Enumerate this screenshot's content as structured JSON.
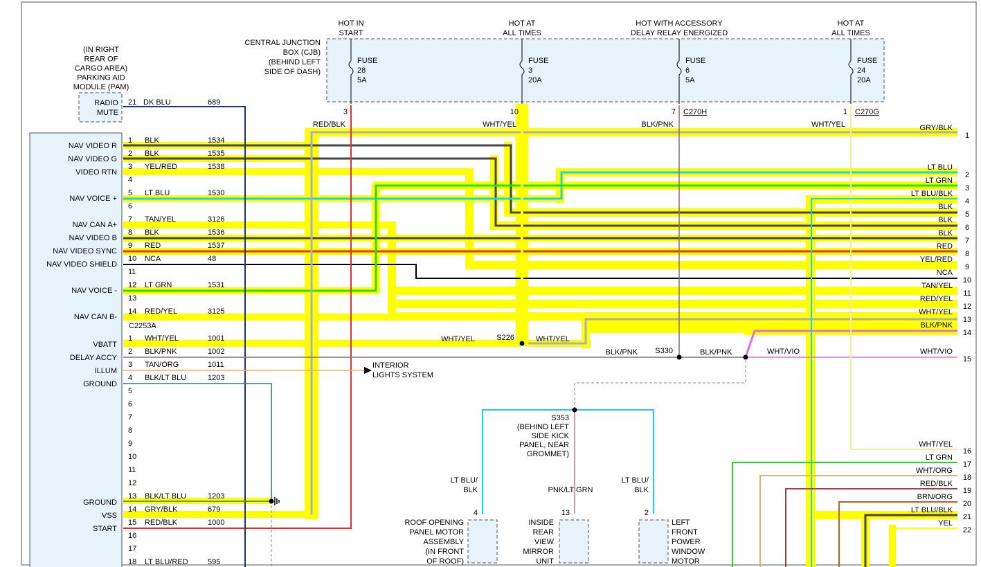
{
  "fuse_panel": {
    "title_lines": [
      "CENTRAL JUNCTION",
      "BOX (CJB)",
      "(BEHIND LEFT",
      "SIDE OF DASH)"
    ],
    "fuses": [
      {
        "hot": [
          "HOT IN",
          "START"
        ],
        "label": "FUSE",
        "number": "28",
        "amps": "5A",
        "pin": "3",
        "connector": "",
        "wire": "RED/BLK"
      },
      {
        "hot": [
          "HOT AT",
          "ALL TIMES"
        ],
        "label": "FUSE",
        "number": "3",
        "amps": "20A",
        "pin": "10",
        "connector": "",
        "wire": "WHT/YEL"
      },
      {
        "hot": [
          "HOT WITH ACCESSORY",
          "DELAY RELAY ENERGIZED"
        ],
        "label": "FUSE",
        "number": "6",
        "amps": "5A",
        "pin": "7",
        "connector": "C270H",
        "wire": "BLK/PNK"
      },
      {
        "hot": [
          "HOT AT",
          "ALL TIMES"
        ],
        "label": "FUSE",
        "number": "24",
        "amps": "20A",
        "pin": "1",
        "connector": "C270G",
        "wire": "WHT/YEL"
      }
    ]
  },
  "pam": {
    "title_lines": [
      "(IN RIGHT",
      "REAR OF",
      "CARGO AREA)",
      "PARKING AID",
      "MODULE (PAM)"
    ],
    "box_lines": [
      "RADIO",
      "MUTE"
    ],
    "pin": "21",
    "color": "DK BLU",
    "circuit": "689"
  },
  "module_a": {
    "connector": "C2253A",
    "pins": [
      {
        "pin": "1",
        "color": "BLK",
        "circuit": "1534",
        "func": "NAV VIDEO R"
      },
      {
        "pin": "2",
        "color": "BLK",
        "circuit": "1535",
        "func": "NAV VIDEO G"
      },
      {
        "pin": "3",
        "color": "YEL/RED",
        "circuit": "1538",
        "func": "VIDEO RTN"
      },
      {
        "pin": "4",
        "color": "",
        "circuit": "",
        "func": ""
      },
      {
        "pin": "5",
        "color": "LT BLU",
        "circuit": "1530",
        "func": "NAV VOICE +"
      },
      {
        "pin": "6",
        "color": "",
        "circuit": "",
        "func": ""
      },
      {
        "pin": "7",
        "color": "TAN/YEL",
        "circuit": "3126",
        "func": "NAV CAN A+"
      },
      {
        "pin": "8",
        "color": "BLK",
        "circuit": "1536",
        "func": "NAV VIDEO B"
      },
      {
        "pin": "9",
        "color": "RED",
        "circuit": "1537",
        "func": "NAV VIDEO SYNC"
      },
      {
        "pin": "10",
        "color": "NCA",
        "circuit": "48",
        "func": "NAV VIDEO SHIELD"
      },
      {
        "pin": "11",
        "color": "",
        "circuit": "",
        "func": ""
      },
      {
        "pin": "12",
        "color": "LT GRN",
        "circuit": "1531",
        "func": "NAV VOICE -"
      },
      {
        "pin": "13",
        "color": "",
        "circuit": "",
        "func": ""
      },
      {
        "pin": "14",
        "color": "RED/YEL",
        "circuit": "3125",
        "func": "NAV CAN B-"
      }
    ]
  },
  "module_b": {
    "pins": [
      {
        "pin": "1",
        "color": "WHT/YEL",
        "circuit": "1001",
        "func": "VBATT"
      },
      {
        "pin": "2",
        "color": "BLK/PNK",
        "circuit": "1002",
        "func": "DELAY ACCY"
      },
      {
        "pin": "3",
        "color": "TAN/ORG",
        "circuit": "1011",
        "func": "ILLUM"
      },
      {
        "pin": "4",
        "color": "BLK/LT BLU",
        "circuit": "1203",
        "func": "GROUND"
      },
      {
        "pin": "5",
        "color": "",
        "circuit": "",
        "func": ""
      },
      {
        "pin": "6",
        "color": "",
        "circuit": "",
        "func": ""
      },
      {
        "pin": "7",
        "color": "",
        "circuit": "",
        "func": ""
      },
      {
        "pin": "8",
        "color": "",
        "circuit": "",
        "func": ""
      },
      {
        "pin": "9",
        "color": "",
        "circuit": "",
        "func": ""
      },
      {
        "pin": "10",
        "color": "",
        "circuit": "",
        "func": ""
      },
      {
        "pin": "11",
        "color": "",
        "circuit": "",
        "func": ""
      },
      {
        "pin": "12",
        "color": "",
        "circuit": "",
        "func": ""
      },
      {
        "pin": "13",
        "color": "BLK/LT BLU",
        "circuit": "1203",
        "func": "GROUND"
      },
      {
        "pin": "14",
        "color": "GRY/BLK",
        "circuit": "679",
        "func": "VSS"
      },
      {
        "pin": "15",
        "color": "RED/BLK",
        "circuit": "1000",
        "func": "START"
      },
      {
        "pin": "16",
        "color": "",
        "circuit": "",
        "func": ""
      },
      {
        "pin": "17",
        "color": "",
        "circuit": "",
        "func": ""
      },
      {
        "pin": "18",
        "color": "LT BLU/RED",
        "circuit": "595",
        "func": ""
      }
    ]
  },
  "right_connector": [
    {
      "pin": "1",
      "color": "GRY/BLK"
    },
    {
      "pin": "2",
      "color": "LT BLU"
    },
    {
      "pin": "3",
      "color": "LT GRN"
    },
    {
      "pin": "3",
      "color": "LT BLU/BLK"
    },
    {
      "pin": "4",
      "color": "BLK"
    },
    {
      "pin": "5",
      "color": "BLK"
    },
    {
      "pin": "6",
      "color": "BLK"
    },
    {
      "pin": "7",
      "color": "RED"
    },
    {
      "pin": "8",
      "color": "YEL/RED"
    },
    {
      "pin": "9",
      "color": "NCA"
    },
    {
      "pin": "10",
      "color": "TAN/YEL"
    },
    {
      "pin": "11",
      "color": "RED/YEL"
    },
    {
      "pin": "12",
      "color": "WHT/YEL"
    },
    {
      "pin": "13",
      "color": "BLK/PNK"
    },
    {
      "pin": "14",
      "color": "WHT/VIO"
    },
    {
      "pin": "15",
      "color": "WHT/YEL"
    },
    {
      "pin": "16",
      "color": "LT GRN"
    },
    {
      "pin": "17",
      "color": "WHT/ORG"
    },
    {
      "pin": "18",
      "color": "RED/BLK"
    },
    {
      "pin": "19",
      "color": "BRN/ORG"
    },
    {
      "pin": "20",
      "color": "LT BLU/BLK"
    },
    {
      "pin": "21",
      "color": "YEL"
    },
    {
      "pin": "22",
      "color": ""
    }
  ],
  "splices": {
    "s226": "S226",
    "s226_left": "WHT/YEL",
    "s226_right": "WHT/YEL",
    "s330": "S330",
    "s330_left": "BLK/PNK",
    "s330_right": "BLK/PNK",
    "wht_vio": "WHT/VIO",
    "s353_lines": [
      "S353",
      "(BEHIND LEFT",
      "SIDE KICK",
      "PANEL, NEAR",
      "GROMMET)"
    ]
  },
  "interior_lights": [
    "INTERIOR",
    "LIGHTS SYSTEM"
  ],
  "components": [
    {
      "pin": "4",
      "wire_lines": [
        "LT BLU/",
        "BLK"
      ],
      "label_lines": [
        "ROOF OPENING",
        "PANEL MOTOR",
        "ASSEMBLY",
        "(IN FRONT",
        "OF ROOF)"
      ]
    },
    {
      "pin": "13",
      "wire_lines": [
        "PNK/LT GRN"
      ],
      "label_lines": [
        "INSIDE",
        "REAR",
        "VIEW",
        "MIRROR",
        "UNIT"
      ]
    },
    {
      "pin": "2",
      "wire_lines": [
        "LT BLU/",
        "BLK"
      ],
      "label_lines": [
        "LEFT",
        "FRONT",
        "POWER",
        "WINDOW",
        "MOTOR"
      ]
    }
  ],
  "colors": {
    "highlight": "#ffff00",
    "box_fill": "#e6f3fb",
    "gray": "#b0b0b0",
    "dark": "#444444",
    "blue": "#1a2e8a",
    "red": "#e03030",
    "cyan": "#20d0e8",
    "green": "#22dd22",
    "pink": "#e070e0",
    "tan": "#e8b070",
    "brown": "#a04040",
    "orange": "#c06020",
    "lightyellow": "#f5f0a0"
  }
}
